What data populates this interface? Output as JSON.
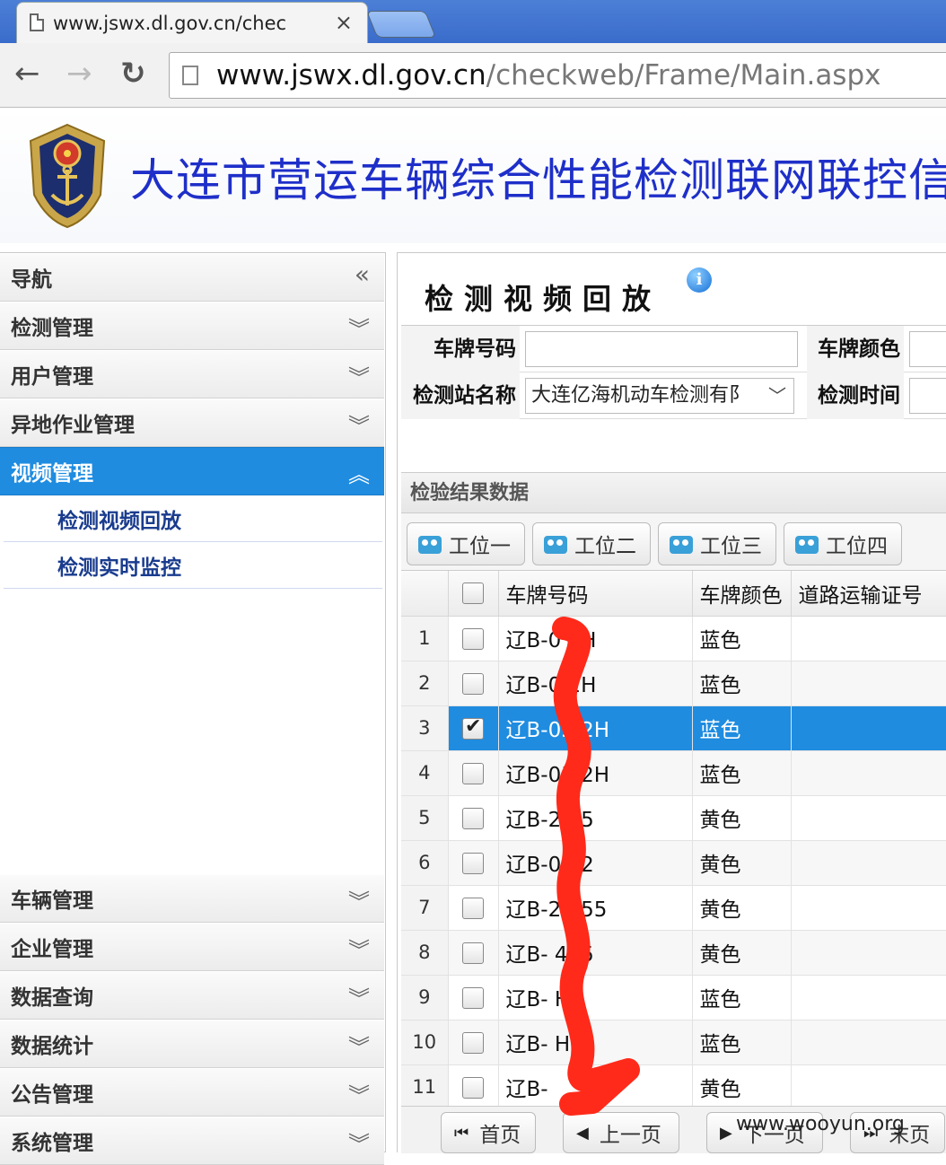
{
  "browser": {
    "tab_title": "www.jswx.dl.gov.cn/chec",
    "tab_close": "×",
    "address_domain": "www.jswx.dl.gov.cn",
    "address_path": "/checkweb/Frame/Main.aspx",
    "back_glyph": "←",
    "forward_glyph": "→",
    "reload_glyph": "↻"
  },
  "banner": {
    "title": "大连市营运车辆综合性能检测联网联控信"
  },
  "sidebar": {
    "nav_header": "导航",
    "nav_collapse": "«",
    "groups_top": [
      {
        "label": "检测管理",
        "chev": "︾"
      },
      {
        "label": "用户管理",
        "chev": "︾"
      },
      {
        "label": "异地作业管理",
        "chev": "︾"
      }
    ],
    "active_group": {
      "label": "视频管理",
      "chev": "︽"
    },
    "sub_items": [
      {
        "label": "检测视频回放"
      },
      {
        "label": "检测实时监控"
      }
    ],
    "groups_bottom": [
      {
        "label": "车辆管理",
        "chev": "︾"
      },
      {
        "label": "企业管理",
        "chev": "︾"
      },
      {
        "label": "数据查询",
        "chev": "︾"
      },
      {
        "label": "数据统计",
        "chev": "︾"
      },
      {
        "label": "公告管理",
        "chev": "︾"
      },
      {
        "label": "系统管理",
        "chev": "︾"
      }
    ]
  },
  "main": {
    "title": "检测视频回放",
    "info_glyph": "i",
    "filter": {
      "plate_label": "车牌号码",
      "plate_value": "",
      "color_label": "车牌颜色",
      "station_label": "检测站名称",
      "station_value": "大连亿海机动车检测有阝",
      "time_label": "检测时间",
      "dropdown_glyph": "﹀"
    },
    "grid_title": "检验结果数据",
    "toolbar_buttons": [
      "工位一",
      "工位二",
      "工位三",
      "工位四"
    ],
    "columns": [
      "车牌号码",
      "车牌颜色",
      "道路运输证号"
    ],
    "rows": [
      {
        "n": "1",
        "plate": "辽B-0  2H",
        "color": "蓝色",
        "checked": false
      },
      {
        "n": "2",
        "plate": "辽B-0  2H",
        "color": "蓝色",
        "checked": false
      },
      {
        "n": "3",
        "plate": "辽B-05  2H",
        "color": "蓝色",
        "checked": true
      },
      {
        "n": "4",
        "plate": "辽B-05  2H",
        "color": "蓝色",
        "checked": false
      },
      {
        "n": "5",
        "plate": "辽B-2   55",
        "color": "黄色",
        "checked": false
      },
      {
        "n": "6",
        "plate": "辽B-0   12",
        "color": "黄色",
        "checked": false
      },
      {
        "n": "7",
        "plate": "辽B-2   455",
        "color": "黄色",
        "checked": false
      },
      {
        "n": "8",
        "plate": "辽B-   455",
        "color": "黄色",
        "checked": false
      },
      {
        "n": "9",
        "plate": "辽B-    H",
        "color": "蓝色",
        "checked": false
      },
      {
        "n": "10",
        "plate": "辽B-    H",
        "color": "蓝色",
        "checked": false
      },
      {
        "n": "11",
        "plate": "辽B-",
        "color": "黄色",
        "checked": false
      }
    ],
    "pager": {
      "first": "首页",
      "first_glyph": "⏮",
      "prev": "上一页",
      "prev_glyph": "◀",
      "next": "下一页",
      "next_glyph": "▶",
      "last": "末页",
      "last_glyph": "⏭"
    }
  },
  "watermark": "www.wooyun.org",
  "colors": {
    "accent": "#1f8ce0",
    "title_blue": "#1e2fc9",
    "redaction": "#ff2a1a"
  }
}
